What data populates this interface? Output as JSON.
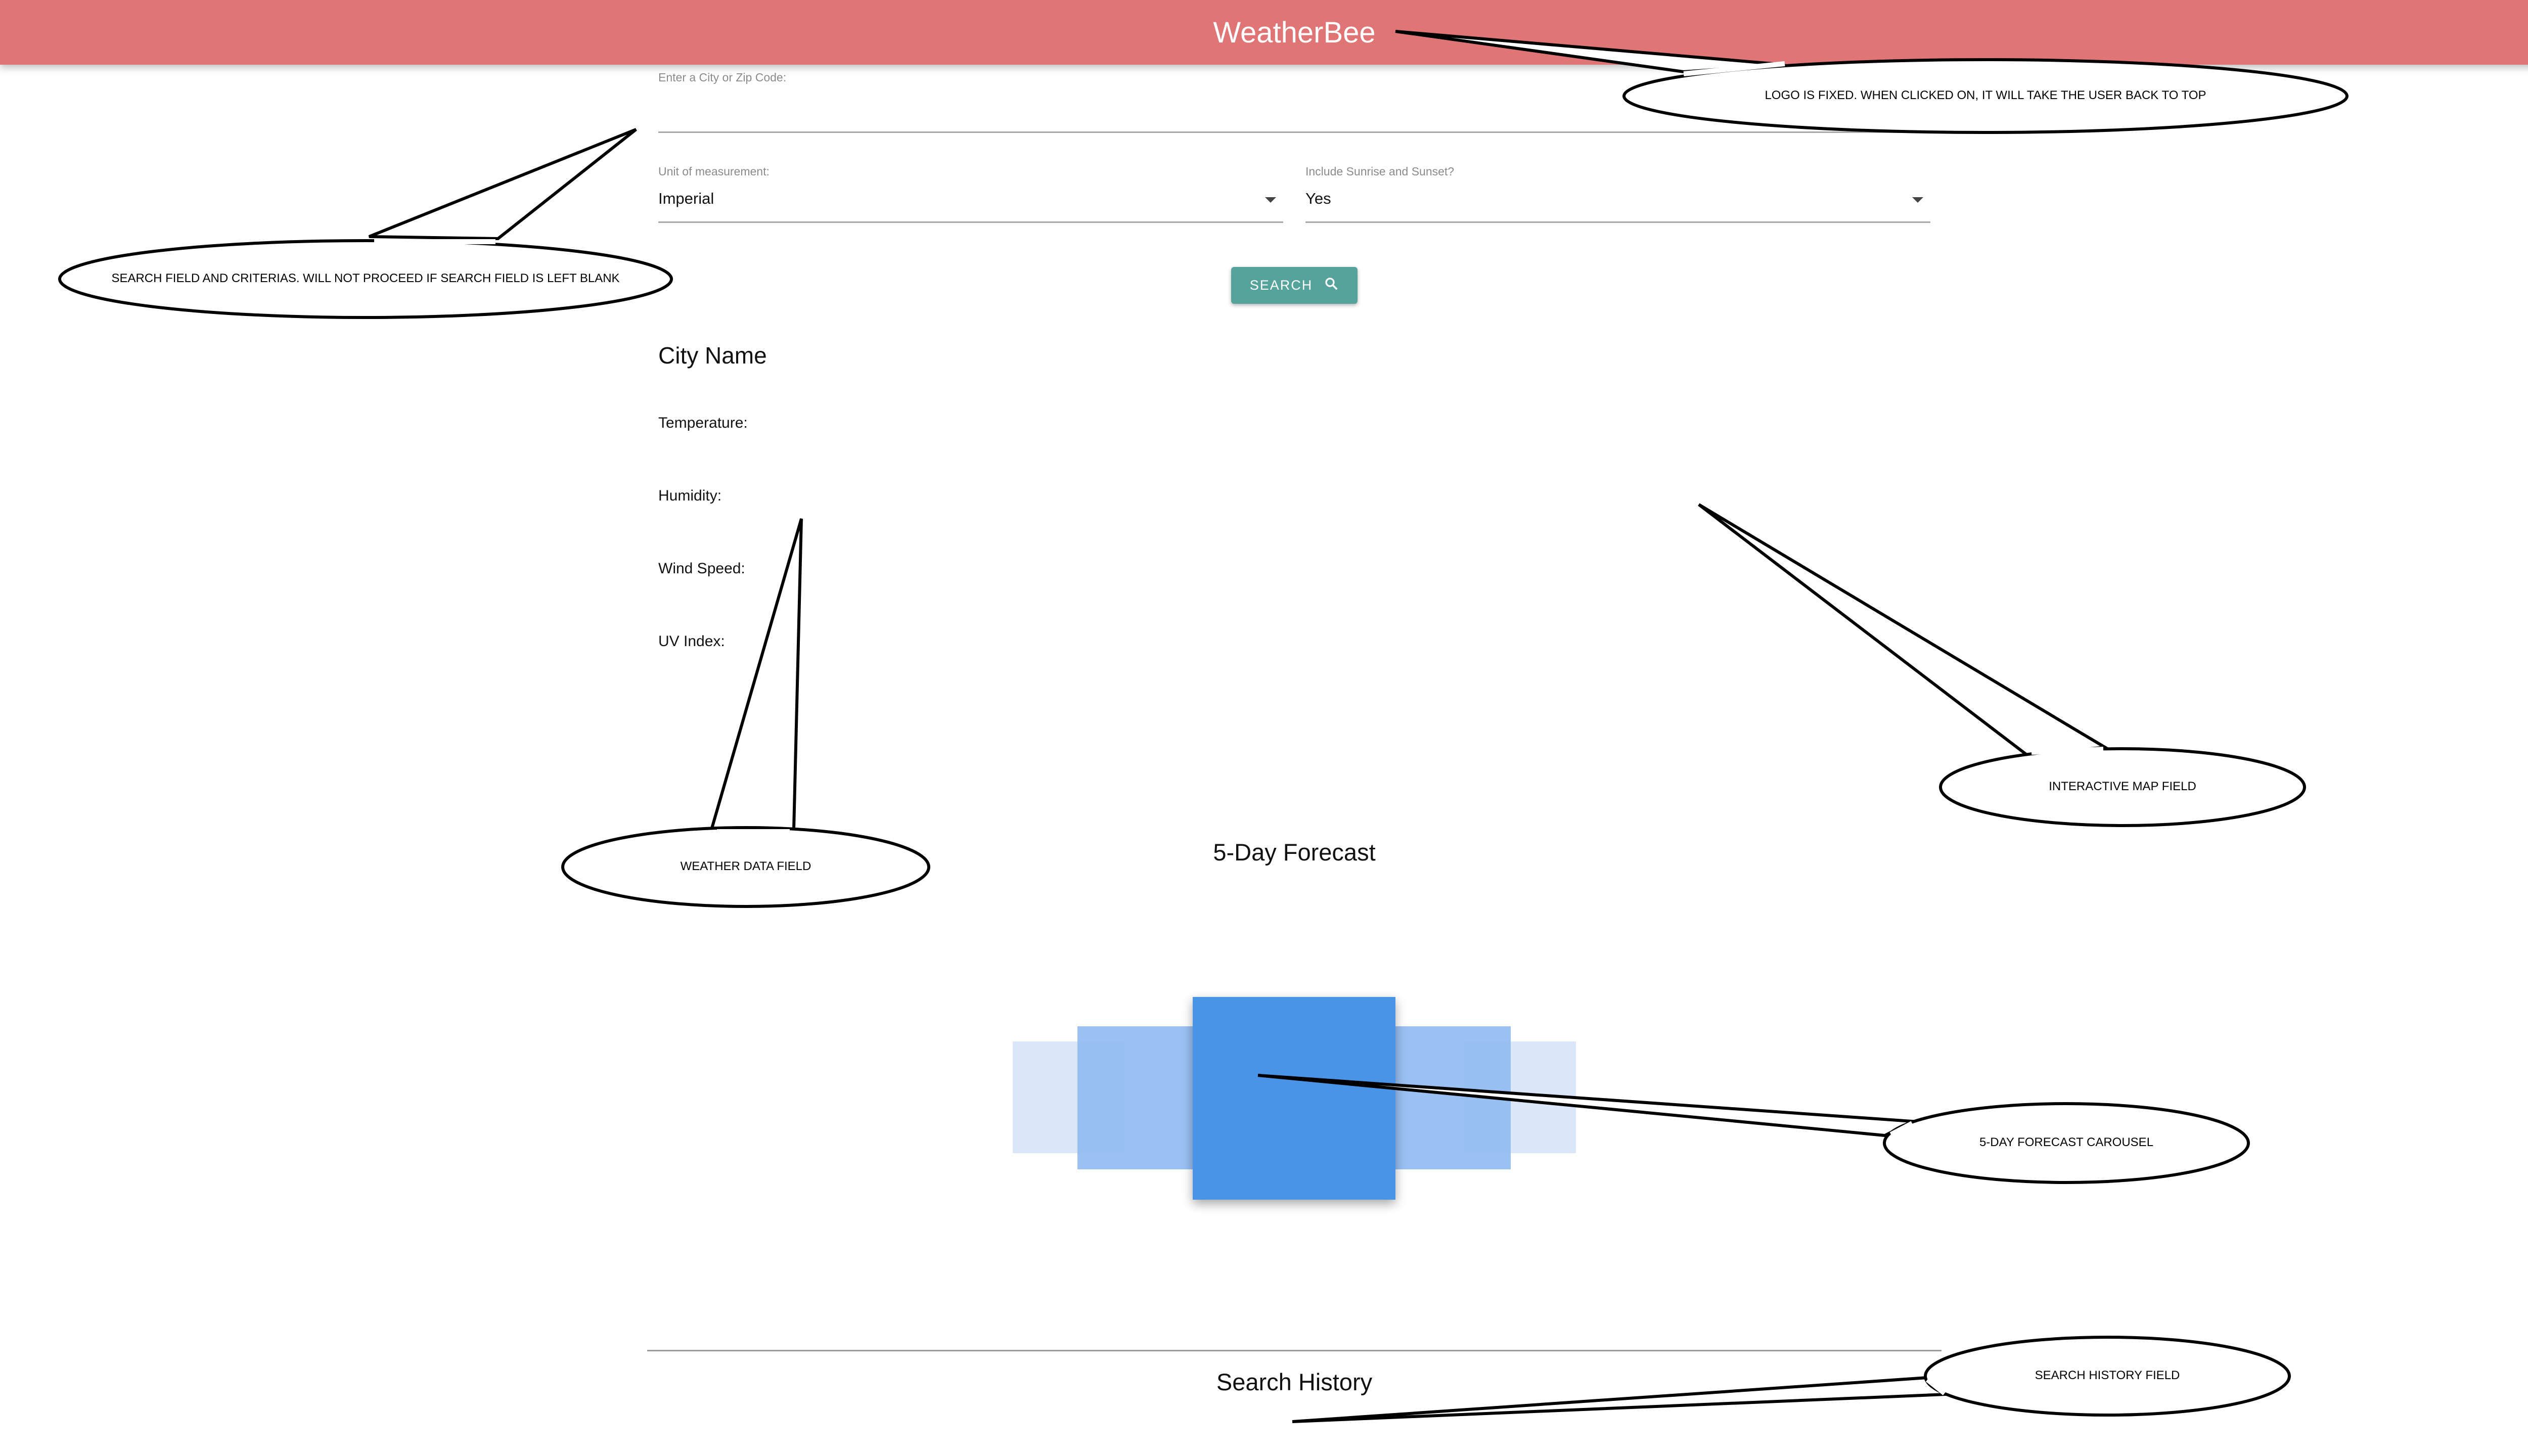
{
  "header": {
    "logo": "WeatherBee"
  },
  "search": {
    "city_label": "Enter a City or Zip Code:",
    "city_value": "",
    "unit_label": "Unit of measurement:",
    "unit_value": "Imperial",
    "sun_label": "Include Sunrise and Sunset?",
    "sun_value": "Yes",
    "button_label": "SEARCH",
    "button_icon": "search-icon"
  },
  "weather": {
    "city_name": "City Name",
    "temperature_label": "Temperature:",
    "humidity_label": "Humidity:",
    "wind_label": "Wind Speed:",
    "uv_label": "UV Index:"
  },
  "forecast": {
    "title": "5-Day Forecast"
  },
  "history": {
    "title": "Search History"
  },
  "colors": {
    "header": "#df7575",
    "button": "#55a39a",
    "card_center": "#4a94e8",
    "card_mid": "#93bcf1",
    "card_outer": "#dbe7f9"
  },
  "annotations": {
    "logo": "LOGO IS FIXED. WHEN CLICKED ON, IT WILL TAKE THE USER BACK TO TOP",
    "search_field": "SEARCH FIELD AND CRITERIAS. WILL NOT PROCEED IF SEARCH FIELD IS LEFT BLANK",
    "weather_data": "WEATHER DATA FIELD",
    "map": "INTERACTIVE MAP FIELD",
    "carousel": "5-DAY FORECAST CAROUSEL",
    "history": "SEARCH HISTORY FIELD"
  }
}
